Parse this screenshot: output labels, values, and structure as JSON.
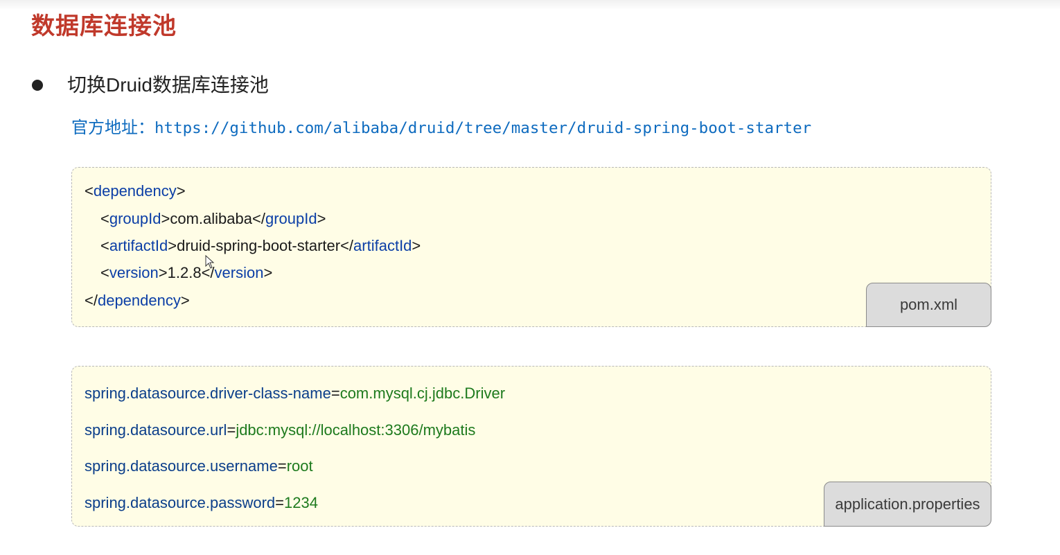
{
  "page": {
    "title": "数据库连接池",
    "bullet": "切换Druid数据库连接池",
    "official_label": "官方地址：",
    "official_url": "https://github.com/alibaba/druid/tree/master/druid-spring-boot-starter"
  },
  "pom_block": {
    "filename": "pom.xml",
    "dependency_tag": "dependency",
    "groupId_tag": "groupId",
    "groupId_value": "com.alibaba",
    "artifactId_tag": "artifactId",
    "artifactId_value": "druid-spring-boot-starter",
    "version_tag": "version",
    "version_value": "1.2.8"
  },
  "properties_block": {
    "filename": "application.properties",
    "lines": [
      {
        "key": "spring.datasource.driver-class-name",
        "value": "com.mysql.cj.jdbc.Driver"
      },
      {
        "key": "spring.datasource.url",
        "value": "jdbc:mysql://localhost:3306/mybatis"
      },
      {
        "key": "spring.datasource.username",
        "value": "root"
      },
      {
        "key": "spring.datasource.password",
        "value": "1234"
      }
    ]
  },
  "colors": {
    "title": "#c0392b",
    "link": "#0e6bbf",
    "xml_tag": "#0b3ea6",
    "prop_key": "#0b3e8a",
    "prop_value": "#1d7a1d",
    "code_background": "#fffde6"
  }
}
